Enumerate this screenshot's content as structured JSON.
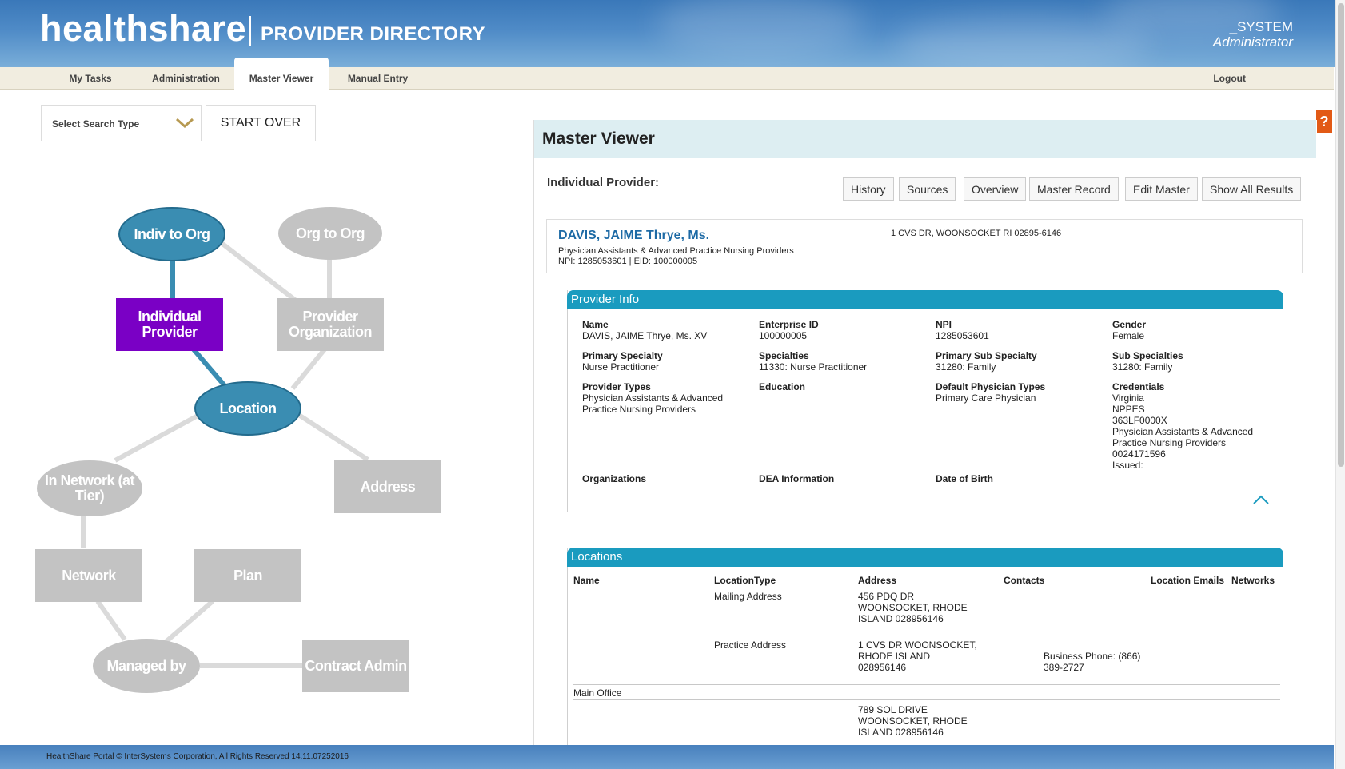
{
  "header": {
    "brand": "healthshare",
    "subtitle": "PROVIDER DIRECTORY",
    "user_name": "_SYSTEM",
    "user_role": "Administrator"
  },
  "nav": {
    "tabs": [
      {
        "label": "My Tasks"
      },
      {
        "label": "Administration"
      },
      {
        "label": "Master Viewer"
      },
      {
        "label": "Manual Entry"
      }
    ],
    "active": "Master Viewer",
    "logout": "Logout"
  },
  "search": {
    "select_label": "Select Search Type",
    "start_over": "START OVER"
  },
  "diagram": {
    "nodes": {
      "indiv_to_org": "Indiv to Org",
      "org_to_org": "Org to Org",
      "individual_provider": "Individual Provider",
      "provider_organization": "Provider Organization",
      "location": "Location",
      "in_network": "In Network (at Tier)",
      "address": "Address",
      "network": "Network",
      "plan": "Plan",
      "managed_by": "Managed by",
      "contract_admin": "Contract Admin"
    }
  },
  "help": {
    "label": "?"
  },
  "panel": {
    "title": "Master Viewer",
    "individual_label": "Individual Provider:",
    "buttons": {
      "history": "History",
      "sources": "Sources",
      "overview": "Overview",
      "master_record": "Master Record",
      "edit_master": "Edit Master",
      "show_all": "Show All Results"
    },
    "provider": {
      "name": "DAVIS, JAIME Thrye, Ms.",
      "type": "Physician Assistants & Advanced Practice Nursing Providers",
      "ids": "NPI: 1285053601 | EID: 100000005",
      "address": "1 CVS DR, WOONSOCKET RI 02895-6146"
    },
    "provider_info": {
      "title": "Provider Info",
      "fields": {
        "name": {
          "label": "Name",
          "value": "DAVIS, JAIME Thrye, Ms. XV"
        },
        "enterprise_id": {
          "label": "Enterprise ID",
          "value": "100000005"
        },
        "npi": {
          "label": "NPI",
          "value": "1285053601"
        },
        "gender": {
          "label": "Gender",
          "value": "Female"
        },
        "primary_specialty": {
          "label": "Primary Specialty",
          "value": "Nurse Practitioner"
        },
        "specialties": {
          "label": "Specialties",
          "value": "11330: Nurse Practitioner"
        },
        "primary_sub_specialty": {
          "label": "Primary Sub Specialty",
          "value": "31280: Family"
        },
        "sub_specialties": {
          "label": "Sub Specialties",
          "value": "31280: Family"
        },
        "provider_types": {
          "label": "Provider Types",
          "value": "Physician Assistants & Advanced Practice Nursing Providers"
        },
        "education": {
          "label": "Education",
          "value": ""
        },
        "default_physician_types": {
          "label": "Default Physician Types",
          "value": "Primary Care Physician"
        },
        "credentials": {
          "label": "Credentials",
          "state": "Virginia",
          "source": "NPPES",
          "code": "363LF0000X",
          "type": "Physician Assistants & Advanced Practice Nursing Providers",
          "number": "0024171596",
          "issued": "Issued:"
        },
        "organizations": {
          "label": "Organizations"
        },
        "dea": {
          "label": "DEA Information"
        },
        "dob": {
          "label": "Date of Birth"
        }
      }
    },
    "locations": {
      "title": "Locations",
      "columns": [
        "Name",
        "LocationType",
        "Address",
        "Contacts",
        "Location Emails",
        "Networks"
      ],
      "rows": [
        {
          "name": "",
          "type": "Mailing Address",
          "address": "456 PDQ DR WOONSOCKET, RHODE ISLAND 028956146",
          "contacts": ""
        },
        {
          "name": "",
          "type": "Practice Address",
          "address": "1 CVS DR WOONSOCKET, RHODE ISLAND 028956146",
          "contacts": "Business Phone: (866) 389-2727"
        },
        {
          "name": "Main Office",
          "type": "",
          "address": "",
          "contacts": ""
        },
        {
          "name": "",
          "type": "",
          "address": "789 SOL DRIVE WOONSOCKET, RHODE ISLAND 028956146",
          "contacts": ""
        }
      ]
    }
  },
  "footer": {
    "copyright": "HealthShare Portal © InterSystems Corporation, All Rights Reserved 14.11.07252016"
  },
  "colors": {
    "header_blue": "#3a78b9",
    "section_teal": "#1a9bbf",
    "provider_name_blue": "#1d6aa5",
    "node_blue": "#3a8db2",
    "node_purple": "#7a00c5",
    "node_grey": "#c3c3c3",
    "help_orange": "#e25a16"
  }
}
